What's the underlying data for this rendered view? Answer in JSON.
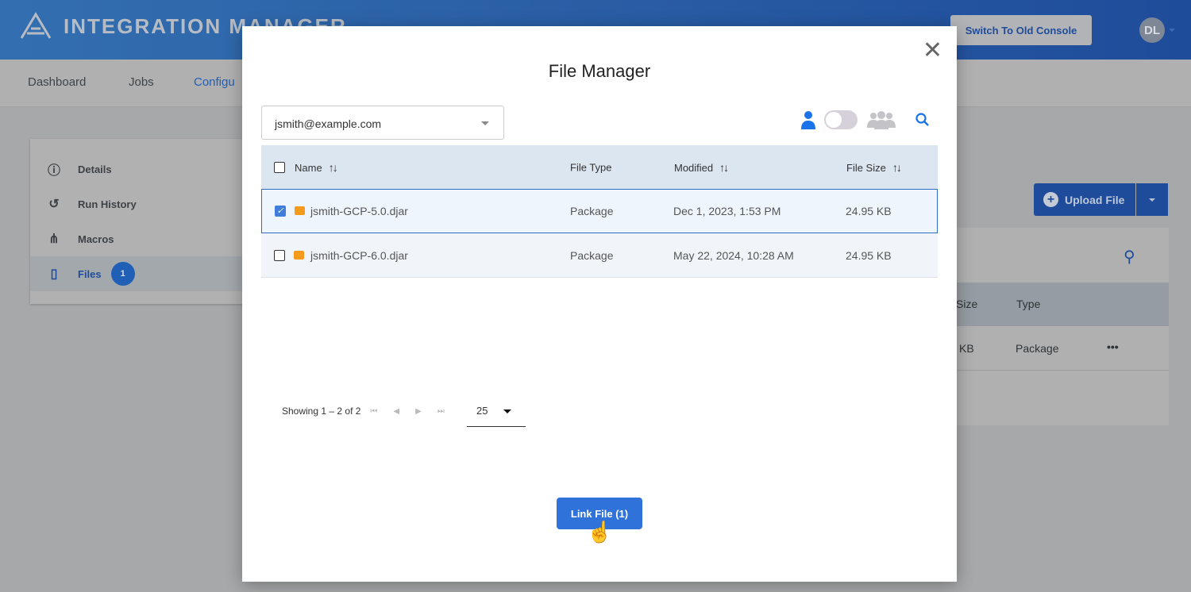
{
  "app": {
    "title": "INTEGRATION MANAGER",
    "switch_console": "Switch To Old Console",
    "avatar_initials": "DL"
  },
  "nav": [
    "Dashboard",
    "Jobs",
    "Configu"
  ],
  "sidebar": [
    {
      "label": "Details",
      "icon": "info-icon"
    },
    {
      "label": "Run History",
      "icon": "history-icon"
    },
    {
      "label": "Macros",
      "icon": "macros-icon"
    },
    {
      "label": "Files",
      "icon": "file-icon",
      "badge": "1"
    }
  ],
  "background": {
    "upload_label": "Upload File",
    "col_size": "Size",
    "col_type": "Type",
    "row_size": "KB",
    "row_type": "Package",
    "row_more": "•••"
  },
  "modal": {
    "title": "File Manager",
    "user_select": "jsmith@example.com",
    "columns": {
      "name": "Name",
      "file_type": "File Type",
      "modified": "Modified",
      "file_size": "File Size"
    },
    "rows": [
      {
        "name": "jsmith-GCP-5.0.djar",
        "type": "Package",
        "modified": "Dec 1, 2023, 1:53 PM",
        "size": "24.95 KB",
        "checked": true
      },
      {
        "name": "jsmith-GCP-6.0.djar",
        "type": "Package",
        "modified": "May 22, 2024, 10:28 AM",
        "size": "24.95 KB",
        "checked": false
      }
    ],
    "pagination": {
      "showing": "Showing 1 – 2 of 2",
      "page_size": "25"
    },
    "link_button": "Link File (1)"
  },
  "colors": {
    "accent": "#2f72d9",
    "header": "#1f4c9a"
  }
}
